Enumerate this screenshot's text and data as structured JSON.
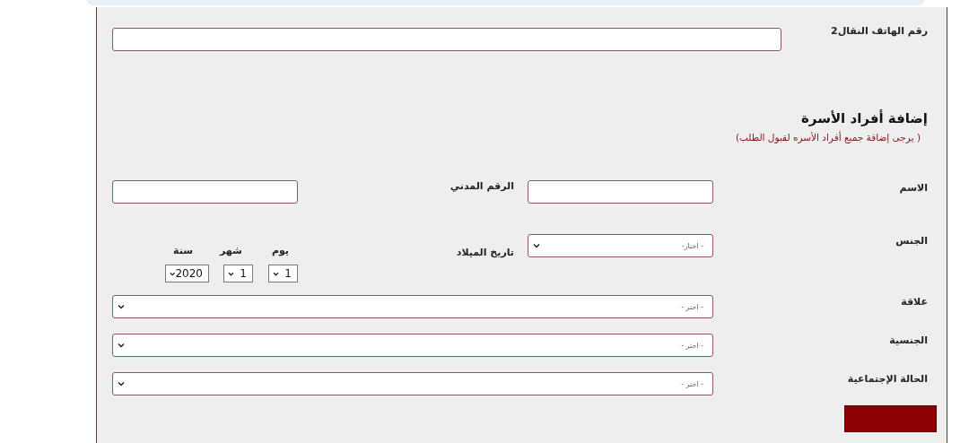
{
  "phone2": {
    "label": "رقم الهاتف النقال2"
  },
  "family_section": {
    "title": "إضافة أفراد الأسرة",
    "note": "( يرجى إضافة جميع أفراد الأسره لقبول الطلب)"
  },
  "name": {
    "label": "الاسم"
  },
  "civil_id": {
    "label": "الرقم المدني"
  },
  "gender": {
    "label": "الجنس",
    "placeholder": "- اختار-"
  },
  "birth_date": {
    "label": "تاريخ الميلاد",
    "parts": [
      {
        "label": "يوم",
        "value": "1"
      },
      {
        "label": "شهر",
        "value": "1"
      },
      {
        "label": "سنة",
        "value": "2020"
      }
    ]
  },
  "wide_selects": [
    {
      "label": "علاقة",
      "placeholder": "- اختر -"
    },
    {
      "label": "الجنسية",
      "placeholder": "- اختر -"
    },
    {
      "label": "الحالة الإجتماعية",
      "placeholder": "- اختر -"
    }
  ]
}
